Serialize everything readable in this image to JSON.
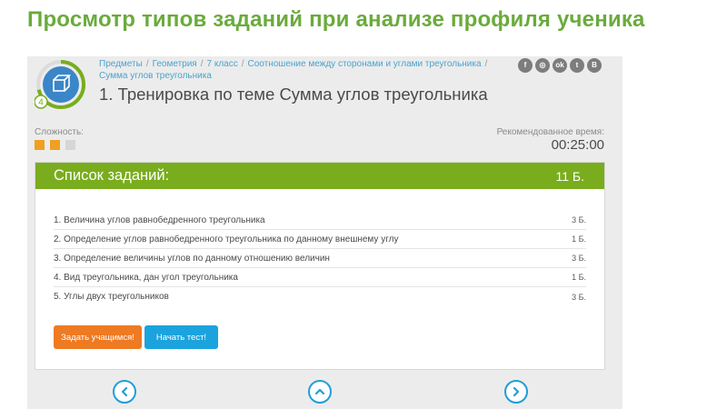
{
  "slide_title": "Просмотр типов заданий при анализе профиля ученика",
  "colors": {
    "title_green": "#6aab3c",
    "header_green": "#79ad1d",
    "orange": "#ee7a22",
    "blue": "#1ba3dd",
    "difficulty_on": "#f0a020",
    "difficulty_off": "#d6d6d6"
  },
  "badge": {
    "icon": "cube-icon",
    "progress_number": "4"
  },
  "breadcrumbs": [
    "Предметы",
    "Геометрия",
    "7 класс",
    "Соотношение между сторонами и углами треугольника",
    "Сумма углов треугольника"
  ],
  "page_title": "1. Тренировка по теме Сумма углов треугольника",
  "social_icons": [
    "facebook-icon",
    "odnoklassniki-icon",
    "odnoklassniki-icon",
    "twitter-icon",
    "vk-icon"
  ],
  "difficulty": {
    "label": "Сложность:",
    "level": 2,
    "max": 3
  },
  "recommended": {
    "label": "Рекомендованное время:",
    "time": "00:25:00"
  },
  "task_list": {
    "title": "Список заданий:",
    "total": "11 Б.",
    "tasks": [
      {
        "label": "1.  Величина углов равнобедренного треугольника",
        "points": "3 Б."
      },
      {
        "label": "2.  Определение углов равнобедренного треугольника по данному внешнему углу",
        "points": "1 Б."
      },
      {
        "label": "3.  Определение величины углов по данному отношению величин",
        "points": "3 Б."
      },
      {
        "label": "4.  Вид треугольника, дан угол треугольника",
        "points": "1 Б."
      },
      {
        "label": "5.  Углы двух треугольников",
        "points": "3 Б."
      }
    ]
  },
  "buttons": {
    "assign": "Задать учащимся!",
    "start": "Начать тест!"
  },
  "nav": [
    "chevron-left-icon",
    "chevron-up-icon",
    "chevron-right-icon"
  ]
}
